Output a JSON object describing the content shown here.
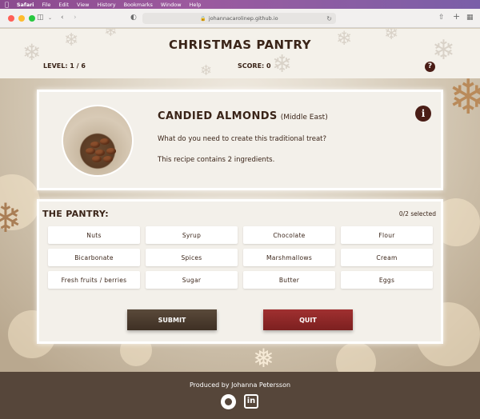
{
  "menubar": {
    "app": "Safari",
    "items": [
      "File",
      "Edit",
      "View",
      "History",
      "Bookmarks",
      "Window",
      "Help"
    ]
  },
  "browser": {
    "url": "johannacarolinep.github.io"
  },
  "header": {
    "title": "CHRISTMAS PANTRY",
    "level": "LEVEL: 1 / 6",
    "score": "SCORE: 0",
    "help_symbol": "?"
  },
  "recipe": {
    "name": "CANDIED ALMONDS",
    "origin": "(Middle East)",
    "question": "What do you need to create this traditional treat?",
    "ingredient_count": "This recipe contains 2 ingredients.",
    "info_symbol": "i"
  },
  "pantry": {
    "title": "THE PANTRY:",
    "selected": "0/2 selected",
    "ingredients": [
      "Nuts",
      "Syrup",
      "Chocolate",
      "Flour",
      "Bicarbonate",
      "Spices",
      "Marshmallows",
      "Cream",
      "Fresh fruits / berries",
      "Sugar",
      "Butter",
      "Eggs"
    ],
    "submit_label": "SUBMIT",
    "quit_label": "QUIT"
  },
  "footer": {
    "credit": "Produced by Johanna Petersson",
    "linkedin": "in"
  },
  "colors": {
    "brand_dark": "#4a1d16",
    "quit": "#8c2828",
    "submit": "#4a3b2e",
    "footer": "#56463a"
  }
}
